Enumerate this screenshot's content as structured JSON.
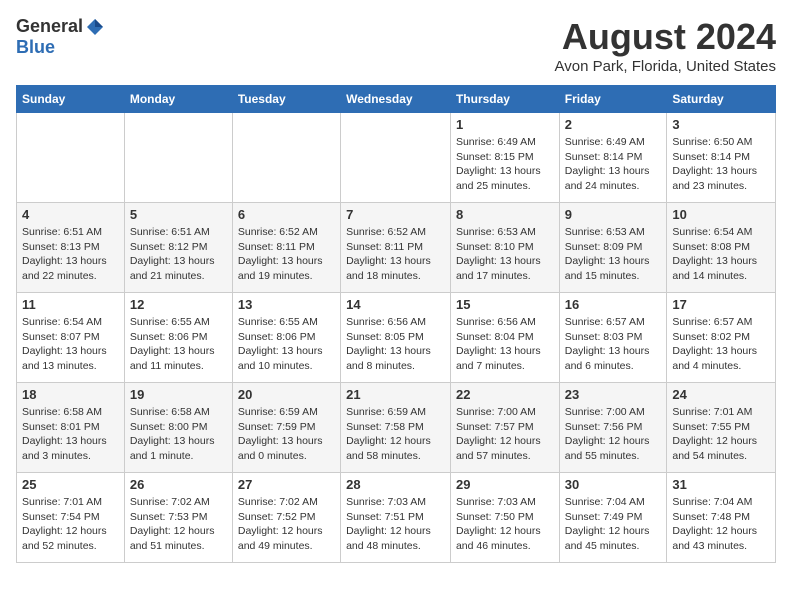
{
  "header": {
    "logo_general": "General",
    "logo_blue": "Blue",
    "month_title": "August 2024",
    "location": "Avon Park, Florida, United States"
  },
  "weekdays": [
    "Sunday",
    "Monday",
    "Tuesday",
    "Wednesday",
    "Thursday",
    "Friday",
    "Saturday"
  ],
  "weeks": [
    [
      {
        "day": "",
        "info": ""
      },
      {
        "day": "",
        "info": ""
      },
      {
        "day": "",
        "info": ""
      },
      {
        "day": "",
        "info": ""
      },
      {
        "day": "1",
        "info": "Sunrise: 6:49 AM\nSunset: 8:15 PM\nDaylight: 13 hours\nand 25 minutes."
      },
      {
        "day": "2",
        "info": "Sunrise: 6:49 AM\nSunset: 8:14 PM\nDaylight: 13 hours\nand 24 minutes."
      },
      {
        "day": "3",
        "info": "Sunrise: 6:50 AM\nSunset: 8:14 PM\nDaylight: 13 hours\nand 23 minutes."
      }
    ],
    [
      {
        "day": "4",
        "info": "Sunrise: 6:51 AM\nSunset: 8:13 PM\nDaylight: 13 hours\nand 22 minutes."
      },
      {
        "day": "5",
        "info": "Sunrise: 6:51 AM\nSunset: 8:12 PM\nDaylight: 13 hours\nand 21 minutes."
      },
      {
        "day": "6",
        "info": "Sunrise: 6:52 AM\nSunset: 8:11 PM\nDaylight: 13 hours\nand 19 minutes."
      },
      {
        "day": "7",
        "info": "Sunrise: 6:52 AM\nSunset: 8:11 PM\nDaylight: 13 hours\nand 18 minutes."
      },
      {
        "day": "8",
        "info": "Sunrise: 6:53 AM\nSunset: 8:10 PM\nDaylight: 13 hours\nand 17 minutes."
      },
      {
        "day": "9",
        "info": "Sunrise: 6:53 AM\nSunset: 8:09 PM\nDaylight: 13 hours\nand 15 minutes."
      },
      {
        "day": "10",
        "info": "Sunrise: 6:54 AM\nSunset: 8:08 PM\nDaylight: 13 hours\nand 14 minutes."
      }
    ],
    [
      {
        "day": "11",
        "info": "Sunrise: 6:54 AM\nSunset: 8:07 PM\nDaylight: 13 hours\nand 13 minutes."
      },
      {
        "day": "12",
        "info": "Sunrise: 6:55 AM\nSunset: 8:06 PM\nDaylight: 13 hours\nand 11 minutes."
      },
      {
        "day": "13",
        "info": "Sunrise: 6:55 AM\nSunset: 8:06 PM\nDaylight: 13 hours\nand 10 minutes."
      },
      {
        "day": "14",
        "info": "Sunrise: 6:56 AM\nSunset: 8:05 PM\nDaylight: 13 hours\nand 8 minutes."
      },
      {
        "day": "15",
        "info": "Sunrise: 6:56 AM\nSunset: 8:04 PM\nDaylight: 13 hours\nand 7 minutes."
      },
      {
        "day": "16",
        "info": "Sunrise: 6:57 AM\nSunset: 8:03 PM\nDaylight: 13 hours\nand 6 minutes."
      },
      {
        "day": "17",
        "info": "Sunrise: 6:57 AM\nSunset: 8:02 PM\nDaylight: 13 hours\nand 4 minutes."
      }
    ],
    [
      {
        "day": "18",
        "info": "Sunrise: 6:58 AM\nSunset: 8:01 PM\nDaylight: 13 hours\nand 3 minutes."
      },
      {
        "day": "19",
        "info": "Sunrise: 6:58 AM\nSunset: 8:00 PM\nDaylight: 13 hours\nand 1 minute."
      },
      {
        "day": "20",
        "info": "Sunrise: 6:59 AM\nSunset: 7:59 PM\nDaylight: 13 hours\nand 0 minutes."
      },
      {
        "day": "21",
        "info": "Sunrise: 6:59 AM\nSunset: 7:58 PM\nDaylight: 12 hours\nand 58 minutes."
      },
      {
        "day": "22",
        "info": "Sunrise: 7:00 AM\nSunset: 7:57 PM\nDaylight: 12 hours\nand 57 minutes."
      },
      {
        "day": "23",
        "info": "Sunrise: 7:00 AM\nSunset: 7:56 PM\nDaylight: 12 hours\nand 55 minutes."
      },
      {
        "day": "24",
        "info": "Sunrise: 7:01 AM\nSunset: 7:55 PM\nDaylight: 12 hours\nand 54 minutes."
      }
    ],
    [
      {
        "day": "25",
        "info": "Sunrise: 7:01 AM\nSunset: 7:54 PM\nDaylight: 12 hours\nand 52 minutes."
      },
      {
        "day": "26",
        "info": "Sunrise: 7:02 AM\nSunset: 7:53 PM\nDaylight: 12 hours\nand 51 minutes."
      },
      {
        "day": "27",
        "info": "Sunrise: 7:02 AM\nSunset: 7:52 PM\nDaylight: 12 hours\nand 49 minutes."
      },
      {
        "day": "28",
        "info": "Sunrise: 7:03 AM\nSunset: 7:51 PM\nDaylight: 12 hours\nand 48 minutes."
      },
      {
        "day": "29",
        "info": "Sunrise: 7:03 AM\nSunset: 7:50 PM\nDaylight: 12 hours\nand 46 minutes."
      },
      {
        "day": "30",
        "info": "Sunrise: 7:04 AM\nSunset: 7:49 PM\nDaylight: 12 hours\nand 45 minutes."
      },
      {
        "day": "31",
        "info": "Sunrise: 7:04 AM\nSunset: 7:48 PM\nDaylight: 12 hours\nand 43 minutes."
      }
    ]
  ]
}
